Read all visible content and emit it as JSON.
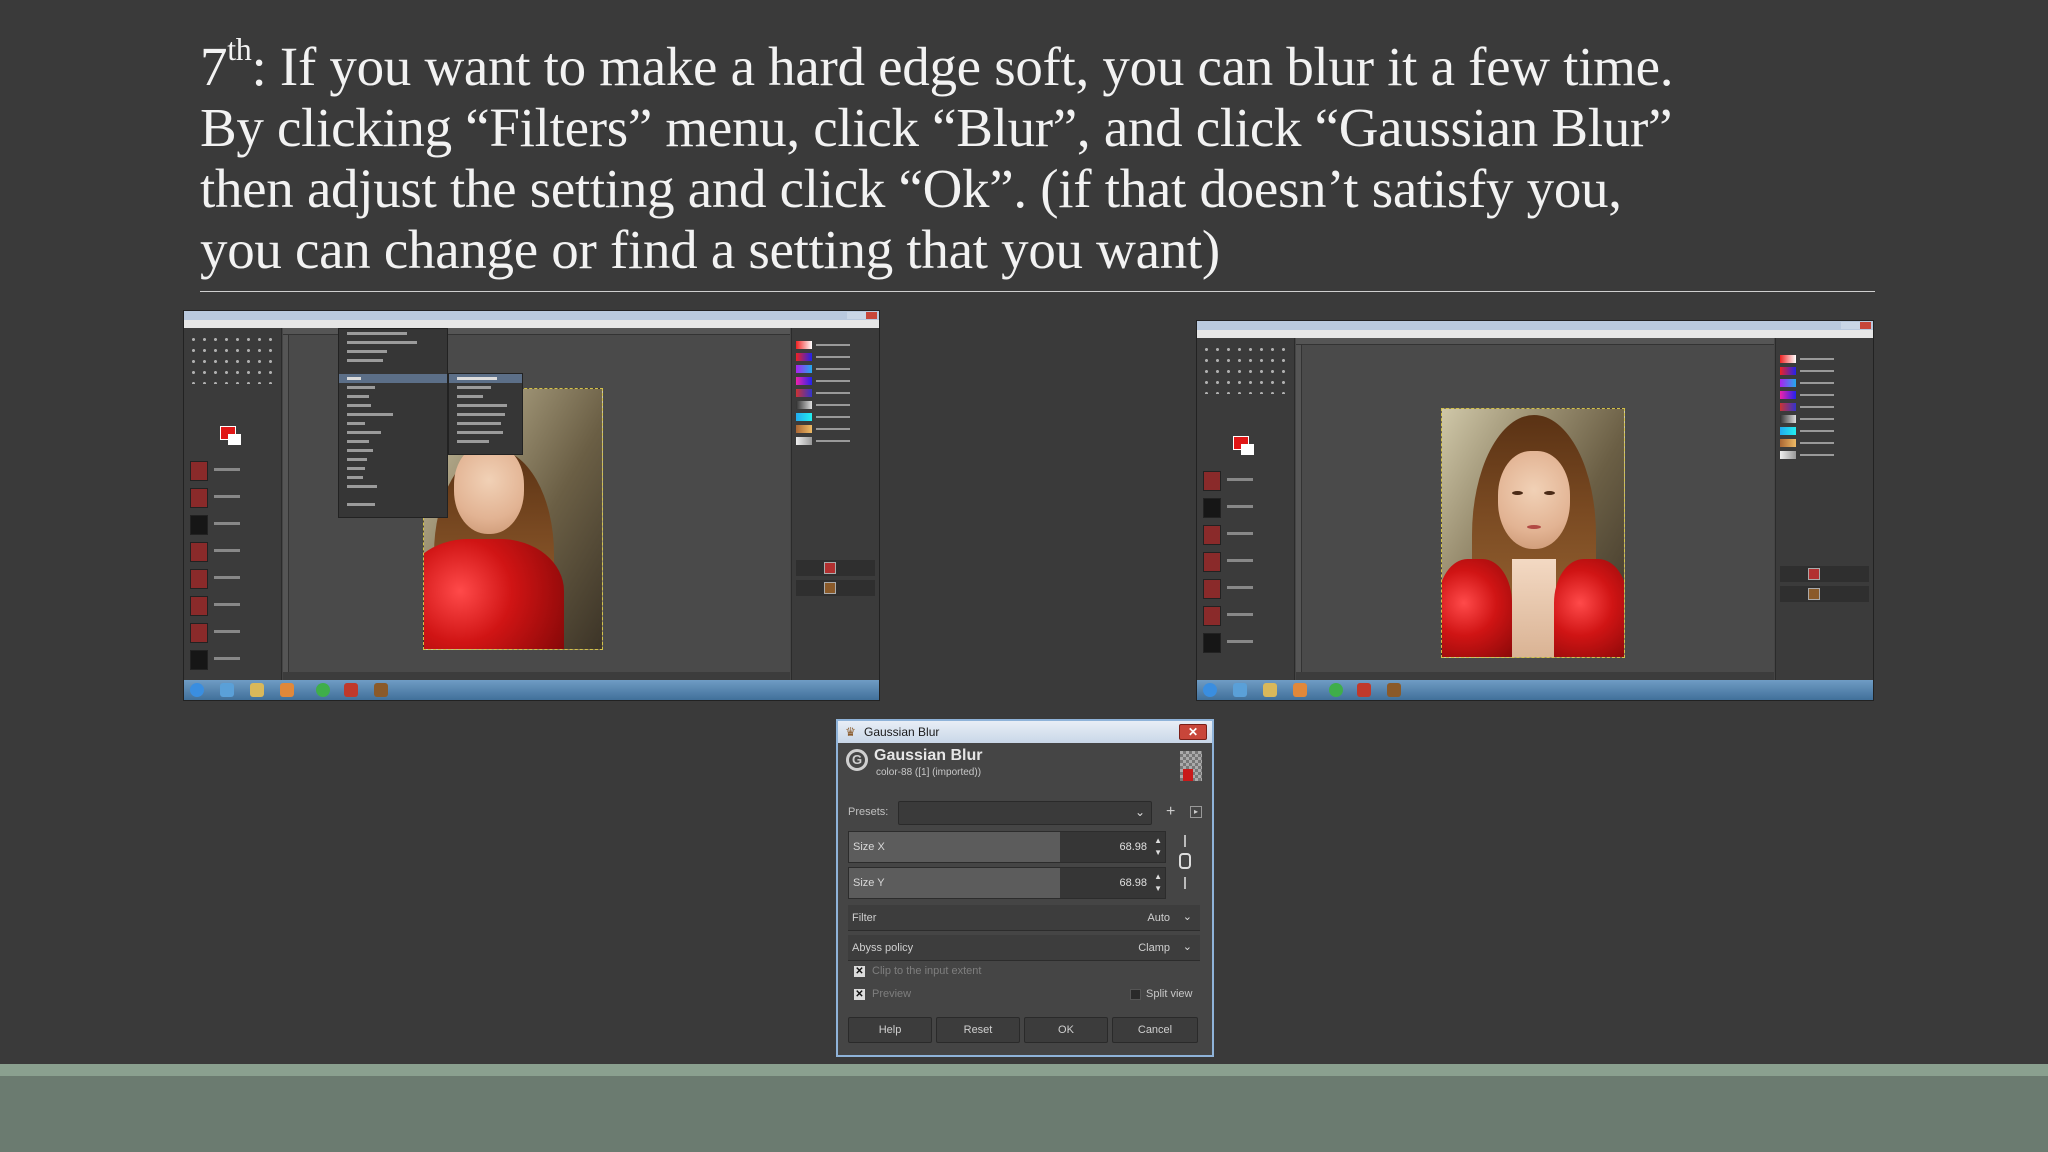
{
  "slide": {
    "title_ordinal": "7",
    "title_ordinal_suffix": "th",
    "title_line1_rest": ": If you want to make a hard edge soft, you can blur it a few time.",
    "title_line2": "By clicking “Filters” menu, click “Blur”, and click “Gaussian Blur”",
    "title_line3": "then adjust the setting and click “Ok”. (if that doesn’t satisfy you,",
    "title_line4": "you can change or find a setting that you want)"
  },
  "colors": {
    "background": "#3a3a3a",
    "title_text": "#f2f2f2",
    "bottom_band": "#6b7b70",
    "dialog_border": "#8fb3d9",
    "swatch_red": "#e01616"
  },
  "screenshots": {
    "left": {
      "description_icon": "gimp-window-filters-blur-menu"
    },
    "right": {
      "description_icon": "gimp-window-blurred-photo"
    }
  },
  "dialog": {
    "title": "Gaussian Blur",
    "close_icon": "close-icon",
    "header_title": "Gaussian Blur",
    "header_subtitle": "color-88 ([1] (imported))",
    "presets_label": "Presets:",
    "presets_value": "",
    "size_x_label": "Size X",
    "size_x_value": "68.98",
    "size_y_label": "Size Y",
    "size_y_value": "68.98",
    "filter_label": "Filter",
    "filter_value": "Auto",
    "abyss_label": "Abyss policy",
    "abyss_value": "Clamp",
    "clip_label": "Clip to the input extent",
    "clip_checked": true,
    "preview_label": "Preview",
    "preview_checked": true,
    "split_view_label": "Split view",
    "split_view_checked": false,
    "buttons": {
      "help": "Help",
      "reset": "Reset",
      "ok": "OK",
      "cancel": "Cancel"
    }
  }
}
